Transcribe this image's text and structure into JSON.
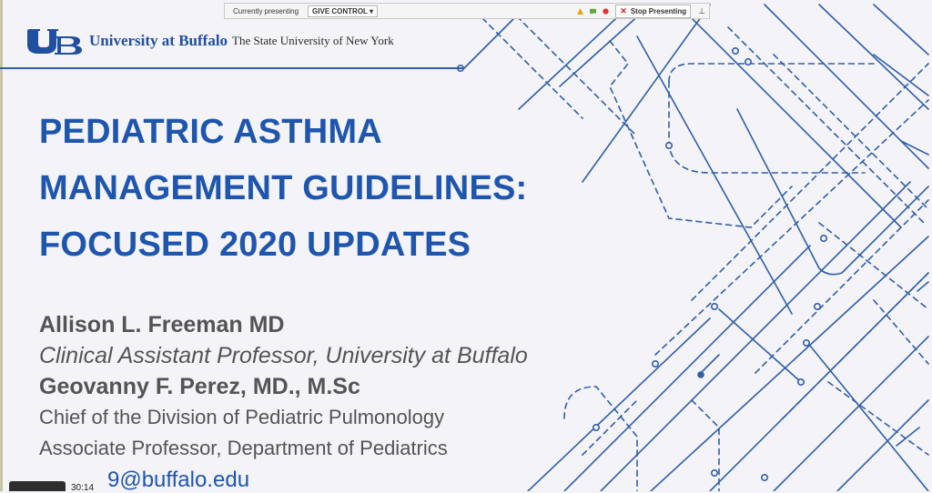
{
  "presenting_bar": {
    "status_text": "Currently presenting",
    "give_control_label": "GIVE CONTROL",
    "stop_label": "Stop Presenting",
    "colors": {
      "warning": "#e9a21b",
      "ok": "#5caa3c",
      "record": "#d83a2b"
    }
  },
  "header": {
    "logo_icon": "ub-logo-icon",
    "university": "University at Buffalo",
    "subtitle": "The State University of New York"
  },
  "title": {
    "line1": "PEDIATRIC ASTHMA",
    "line2": "MANAGEMENT GUIDELINES:",
    "line3": "FOCUSED 2020 UPDATES"
  },
  "authors": {
    "name1": "Allison L. Freeman MD",
    "role1": "Clinical Assistant Professor, University at Buffalo",
    "name2": "Geovanny F. Perez, MD., M.Sc",
    "role2a": "Chief of the Division of Pediatric Pulmonology",
    "role2b": "Associate Professor, Department of Pediatrics",
    "email_partial": "9@buffalo.edu"
  },
  "player": {
    "time": "30:14"
  },
  "colors": {
    "brand_blue": "#1e56ae",
    "text_gray": "#545454",
    "background": "#f4f3f7"
  }
}
